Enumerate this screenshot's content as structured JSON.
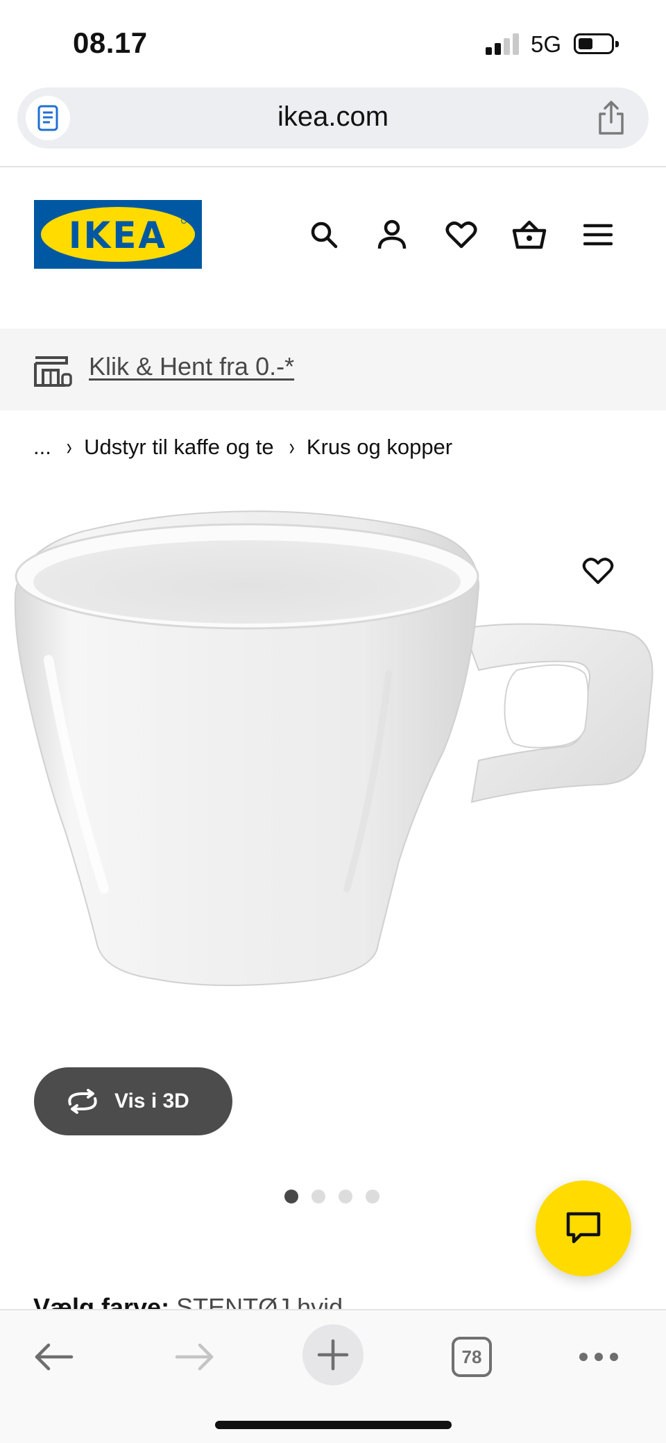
{
  "status_bar": {
    "time": "08.17",
    "network": "5G",
    "signal_bars_active": 2,
    "battery_level": 0.35
  },
  "browser": {
    "url": "ikea.com",
    "reader_icon": "reader-icon",
    "share_icon": "share-icon"
  },
  "header": {
    "logo_text": "IKEA",
    "brand_colors": {
      "blue": "#0058a3",
      "yellow": "#ffdb00"
    },
    "icons": [
      "search-icon",
      "account-icon",
      "favorites-icon",
      "basket-icon",
      "menu-icon"
    ]
  },
  "promo": {
    "icon": "store-icon",
    "link_text": "Klik & Hent fra 0.-*"
  },
  "breadcrumb": {
    "ellipsis": "...",
    "items": [
      "Udstyr til kaffe og te",
      "Krus og kopper"
    ]
  },
  "product": {
    "image_alt": "white-mug",
    "view_3d_label": "Vis i 3D",
    "carousel_pages": 4,
    "carousel_active": 1
  },
  "color_selector": {
    "label": "Vælg farve:",
    "value": "STENTØJ hvid"
  },
  "toolbar": {
    "tab_count": "78",
    "icons": [
      "back-arrow-icon",
      "forward-arrow-icon",
      "plus-icon",
      "tabs-icon",
      "more-icon"
    ]
  }
}
